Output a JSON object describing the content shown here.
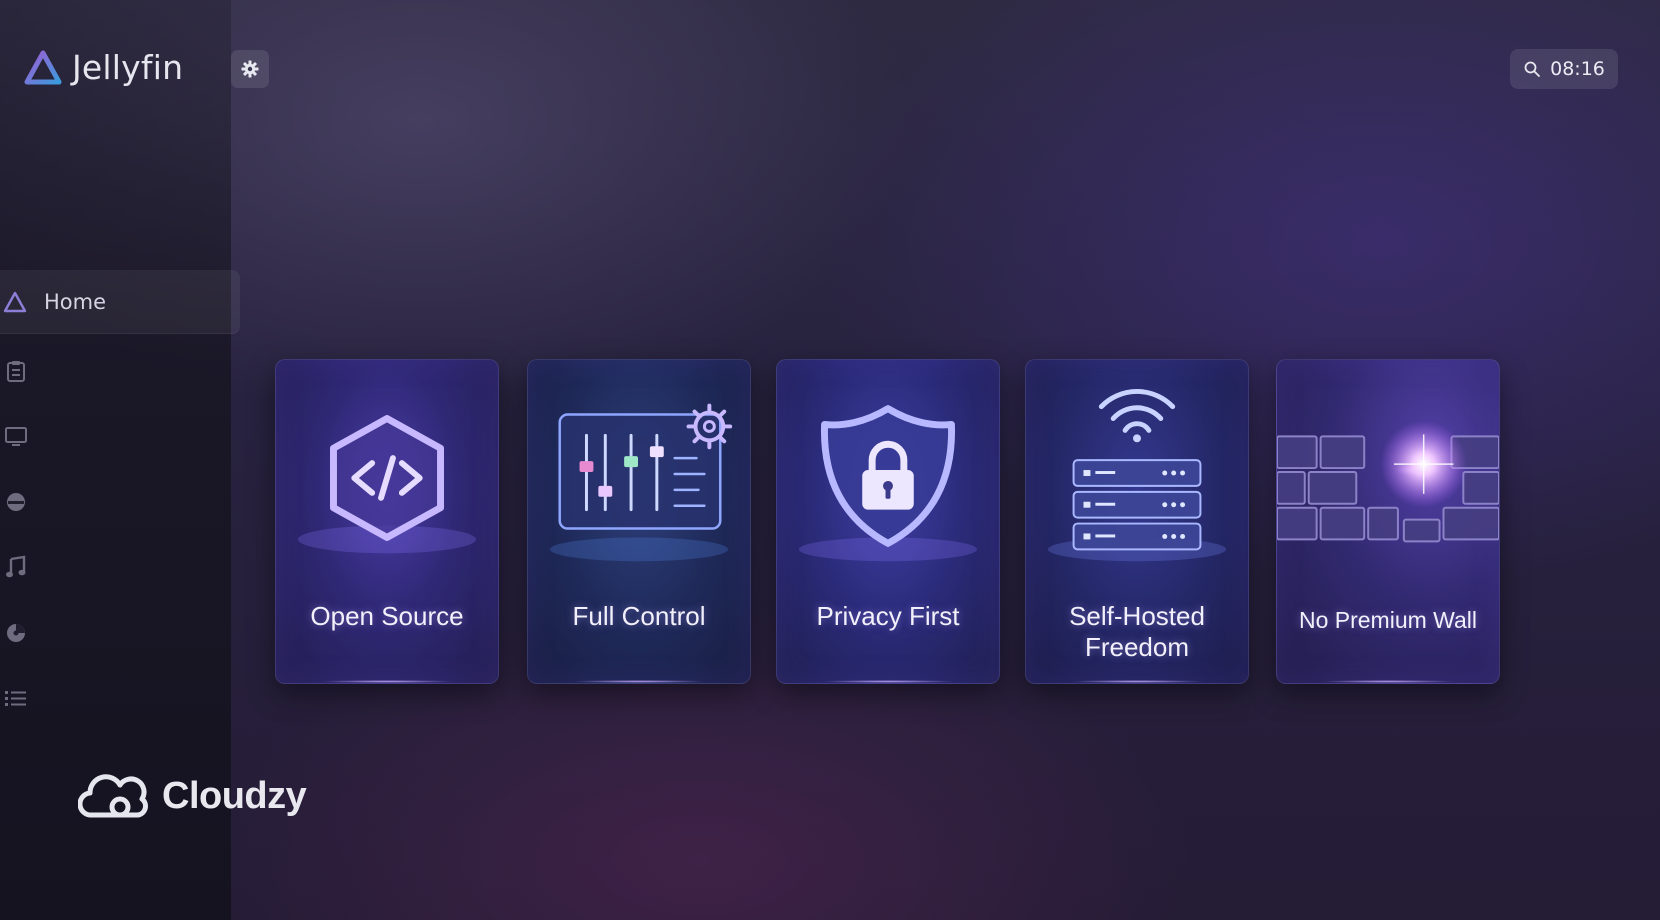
{
  "app": {
    "name": "Jellyfin"
  },
  "header": {
    "clock": "08:16"
  },
  "sidebar": {
    "home_label": "Home",
    "icons": [
      "clipboard-icon",
      "tv-icon",
      "media-icon",
      "music-icon",
      "collection-icon",
      "list-icon"
    ]
  },
  "cards": [
    {
      "label": "Open Source",
      "icon": "code-hexagon-icon"
    },
    {
      "label": "Full Control",
      "icon": "sliders-gear-icon"
    },
    {
      "label": "Privacy First",
      "icon": "shield-lock-icon"
    },
    {
      "label_line1": "Self-Hosted",
      "label_line2": "Freedom",
      "icon": "server-wifi-icon"
    },
    {
      "label": "No Premium Wall",
      "icon": "broken-wall-icon"
    }
  ],
  "brand": {
    "name": "Cloudzy"
  },
  "colors": {
    "accent": "#8a6cff",
    "jellyfin_blue": "#3a9bdc",
    "jellyfin_purple": "#a35bd6"
  }
}
